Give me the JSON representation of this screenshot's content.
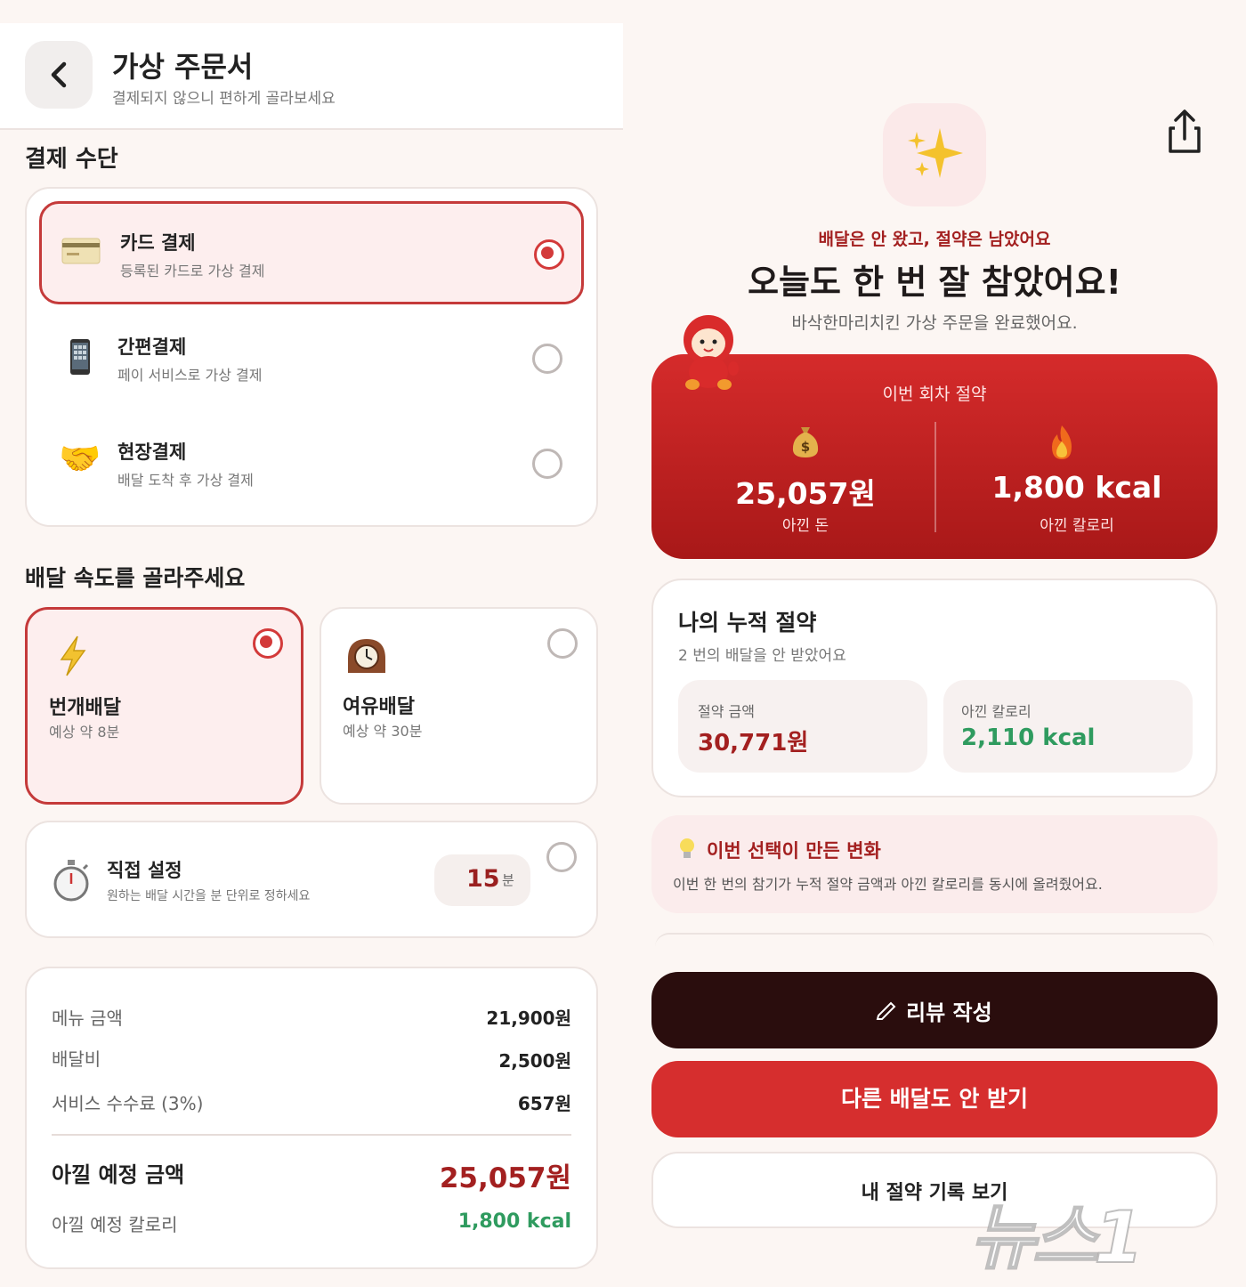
{
  "left": {
    "header": {
      "title": "가상 주문서",
      "subtitle": "결제되지 않으니 편하게 골라보세요"
    },
    "payment": {
      "section_title": "결제 수단",
      "options": [
        {
          "label": "카드 결제",
          "desc": "등록된 카드로 가상 결제",
          "icon": "credit-card-icon",
          "selected": true
        },
        {
          "label": "간편결제",
          "desc": "페이 서비스로 가상 결제",
          "icon": "mobile-phone-icon",
          "selected": false
        },
        {
          "label": "현장결제",
          "desc": "배달 도착 후 가상 결제",
          "icon": "handshake-icon",
          "selected": false
        }
      ]
    },
    "speed": {
      "section_title": "배달 속도를 골라주세요",
      "options": [
        {
          "label": "번개배달",
          "desc": "예상 약 8분",
          "icon": "lightning-icon",
          "selected": true
        },
        {
          "label": "여유배달",
          "desc": "예상 약 30분",
          "icon": "mantel-clock-icon",
          "selected": false
        }
      ],
      "custom": {
        "label": "직접 설정",
        "desc": "원하는 배달 시간을 분 단위로 정하세요",
        "value": "15",
        "unit": "분",
        "icon": "stopwatch-icon"
      }
    },
    "summary": {
      "rows": [
        {
          "label": "메뉴 금액",
          "value": "21,900원"
        },
        {
          "label": "배달비",
          "value": "2,500원"
        },
        {
          "label": "서비스 수수료 (3%)",
          "value": "657원"
        }
      ],
      "total_label": "아낄 예정 금액",
      "total_value": "25,057원",
      "calorie_label": "아낄 예정 칼로리",
      "calorie_value": "1,800 kcal"
    }
  },
  "right": {
    "share_icon": "share-icon",
    "kicker": "배달은 안 왔고, 절약은 남았어요",
    "headline": "오늘도 한 번 잘 참았어요!",
    "subline": "바삭한마리치킨 가상 주문을 완료했어요.",
    "round_card": {
      "title": "이번 회차 절약",
      "money_value": "25,057원",
      "money_label": "아낀 돈",
      "kcal_value": "1,800 kcal",
      "kcal_label": "아낀 칼로리"
    },
    "cumulative": {
      "title": "나의 누적 절약",
      "subtitle": "2 번의 배달을 안 받았어요",
      "money_label": "절약 금액",
      "money_value": "30,771원",
      "kcal_label": "아낀 칼로리",
      "kcal_value": "2,110 kcal"
    },
    "tip": {
      "title": "이번 선택이 만든 변화",
      "text": "이번 한 번의 참기가 누적 절약 금액과 아낀 칼로리를 동시에 올려줬어요."
    },
    "buttons": {
      "review": "리뷰 작성",
      "skip_again": "다른 배달도 안 받기",
      "history": "내 절약 기록 보기"
    },
    "watermark": "뉴스1"
  },
  "colors": {
    "accent_red": "#d33a3a",
    "dark_red": "#9a2020",
    "green": "#2f9b5f",
    "dark_button": "#2a0d0d"
  }
}
